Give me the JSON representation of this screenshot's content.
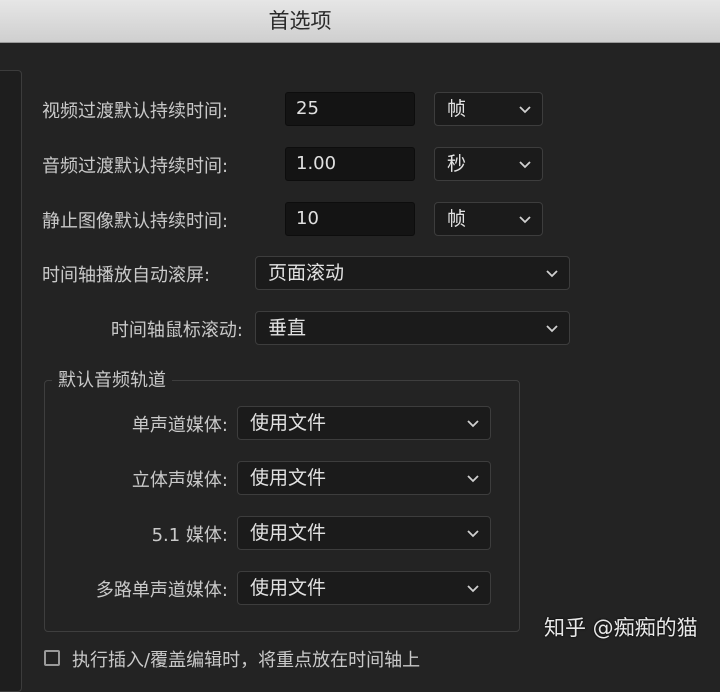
{
  "window": {
    "title": "首选项"
  },
  "rows": {
    "video_transition": {
      "label": "视频过渡默认持续时间:",
      "value": "25",
      "unit": "帧"
    },
    "audio_transition": {
      "label": "音频过渡默认持续时间:",
      "value": "1.00",
      "unit": "秒"
    },
    "still_image": {
      "label": "静止图像默认持续时间:",
      "value": "10",
      "unit": "帧"
    },
    "timeline_autoscroll": {
      "label": "时间轴播放自动滚屏:",
      "value": "页面滚动"
    },
    "timeline_mouse_scroll": {
      "label": "时间轴鼠标滚动:",
      "value": "垂直"
    }
  },
  "audio_tracks": {
    "legend": "默认音频轨道",
    "mono": {
      "label": "单声道媒体:",
      "value": "使用文件"
    },
    "stereo": {
      "label": "立体声媒体:",
      "value": "使用文件"
    },
    "surround": {
      "label": "5.1 媒体:",
      "value": "使用文件"
    },
    "multimono": {
      "label": "多路单声道媒体:",
      "value": "使用文件"
    }
  },
  "bottom_checkbox": {
    "label": "执行插入/覆盖编辑时，将重点放在时间轴上"
  },
  "watermark": "知乎 @痴痴的猫",
  "colors": {
    "background": "#232323",
    "field": "#141414",
    "titlebar": "#dadada"
  }
}
